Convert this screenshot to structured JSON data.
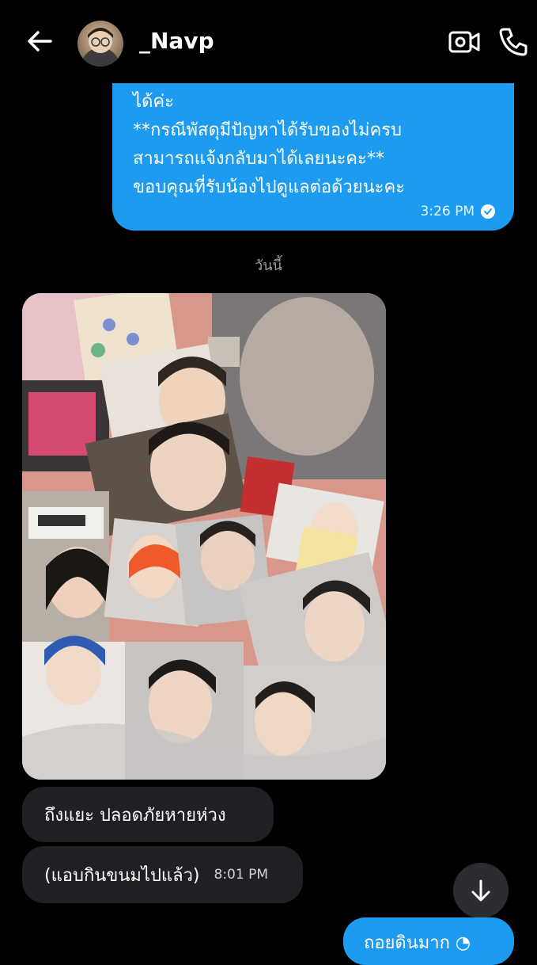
{
  "header": {
    "contact_name": "_Navp",
    "back_icon": "arrow-left-icon",
    "video_icon": "video-camera-icon",
    "call_icon": "phone-icon"
  },
  "outgoing_message": {
    "lines": [
      "ได้ค่ะ",
      "**กรณีพัสดุมีปัญหาได้รับของไม่ครบ",
      "สามารถแจ้งกลับมาได้เลยนะคะ￼**",
      "ขอบคุณที่รับน้องไปดูแลต่อด้วยนะคะ￼￼"
    ],
    "time": "3:26 PM",
    "status_icon": "read-check-icon"
  },
  "day_separator": "วันนี้",
  "incoming_messages": [
    {
      "text": "ถึงแยะ ปลอดภัยหายห่วง",
      "time": ""
    },
    {
      "text": "(แอบกินขนมไปแล้ว)",
      "time": "8:01 PM"
    }
  ],
  "pending_outgoing": {
    "text": "ถอยดินมาก ◔"
  },
  "colors": {
    "background": "#000000",
    "outgoing_bubble": "#1d9bf0",
    "incoming_bubble": "#1f2023"
  }
}
